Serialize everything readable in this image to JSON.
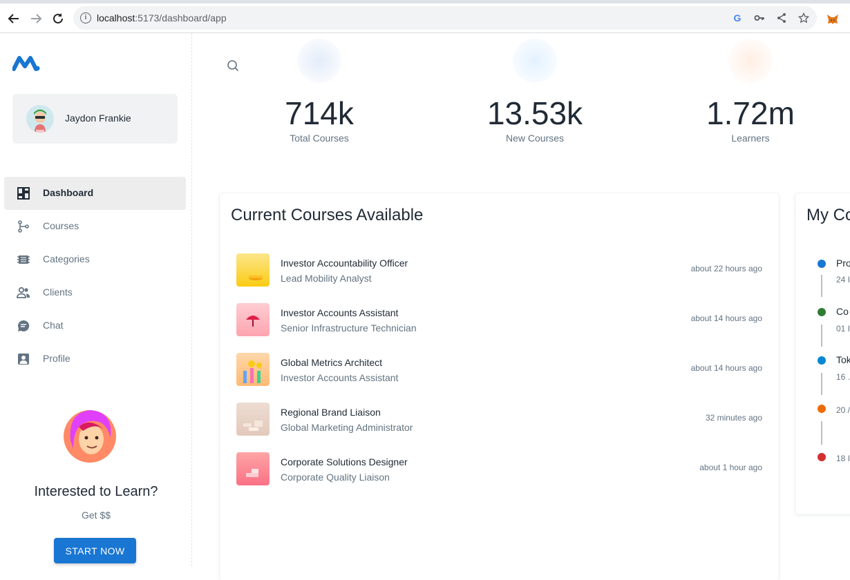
{
  "browser": {
    "url_host": "localhost",
    "url_rest": ":5173/dashboard/app"
  },
  "sidebar": {
    "account_name": "Jaydon Frankie",
    "items": [
      {
        "label": "Dashboard",
        "icon": "dashboard-icon",
        "active": true
      },
      {
        "label": "Courses",
        "icon": "courses-icon",
        "active": false
      },
      {
        "label": "Categories",
        "icon": "categories-icon",
        "active": false
      },
      {
        "label": "Clients",
        "icon": "clients-icon",
        "active": false
      },
      {
        "label": "Chat",
        "icon": "chat-icon",
        "active": false
      },
      {
        "label": "Profile",
        "icon": "profile-icon",
        "active": false
      }
    ],
    "promo": {
      "title": "Interested to Learn?",
      "subtitle": "Get $$",
      "button": "START NOW"
    }
  },
  "stats": [
    {
      "value": "714k",
      "label": "Total Courses",
      "color": "#2065d1"
    },
    {
      "value": "13.53k",
      "label": "New Courses",
      "color": "#1890ff"
    },
    {
      "value": "1.72m",
      "label": "Learners",
      "color": "#ff8a3d"
    }
  ],
  "courses_card": {
    "title": "Current Courses Available",
    "rows": [
      {
        "name": "Investor Accountability Officer",
        "sub": "Lead Mobility Analyst",
        "time": "about 22 hours ago"
      },
      {
        "name": "Investor Accounts Assistant",
        "sub": "Senior Infrastructure Technician",
        "time": "about 14 hours ago"
      },
      {
        "name": "Global Metrics Architect",
        "sub": "Investor Accounts Assistant",
        "time": "about 14 hours ago"
      },
      {
        "name": "Regional Brand Liaison",
        "sub": "Global Marketing Administrator",
        "time": "32 minutes ago"
      },
      {
        "name": "Corporate Solutions Designer",
        "sub": "Corporate Quality Liaison",
        "time": "about 1 hour ago"
      }
    ]
  },
  "my_courses_card": {
    "title": "My Co",
    "items": [
      {
        "title": "Pro",
        "date": "24 I",
        "color": "#1976d2"
      },
      {
        "title": "Co",
        "date": "01 I",
        "color": "#2e7d32"
      },
      {
        "title": "Tok",
        "date": "16 .",
        "color": "#0288d1"
      },
      {
        "title": "",
        "date": "20 /",
        "color": "#ed6c02"
      },
      {
        "title": "",
        "date": "18 I",
        "color": "#d32f2f"
      }
    ]
  },
  "colors": {
    "accent": "#1976d2",
    "active_nav_bg": "#ededed",
    "text_primary": "#212b36",
    "text_secondary": "#637381"
  }
}
